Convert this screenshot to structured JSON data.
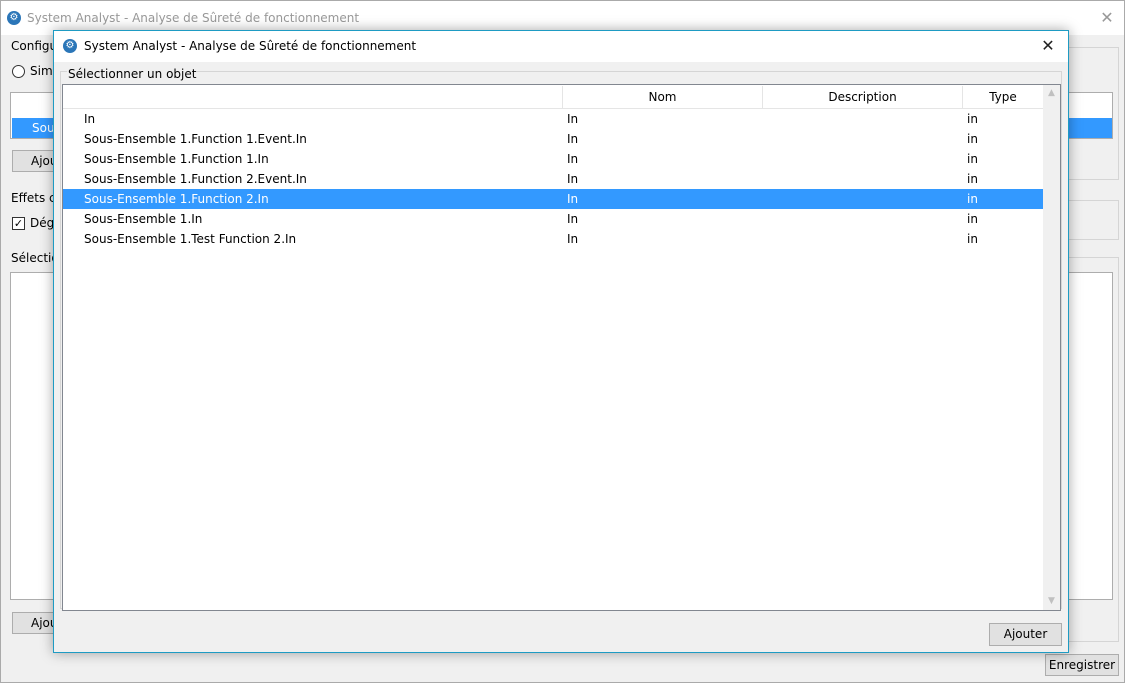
{
  "background_window": {
    "title": "System Analyst - Analyse de Sûreté de fonctionnement",
    "close_glyph": "✕",
    "configuration_label": "Configu",
    "radio_label": "Simp",
    "list_selected_item": "Sous",
    "add_button_1": "Ajou",
    "effects_label": "Effets co",
    "checkbox_label": "Dégr",
    "checkbox_checked": true,
    "selection_label": "Sélection",
    "add_button_2": "Ajou",
    "save_button": "Enregistrer"
  },
  "dialog": {
    "title": "System Analyst - Analyse de Sûreté de fonctionnement",
    "close_glyph": "✕",
    "icon": "gear-icon",
    "group_label": "Sélectionner un objet",
    "columns": {
      "nom": "Nom",
      "description": "Description",
      "type": "Type"
    },
    "rows": [
      {
        "name": "In",
        "nom": "In",
        "description": "",
        "type": "in",
        "selected": false
      },
      {
        "name": "Sous-Ensemble 1.Function 1.Event.In",
        "nom": "In",
        "description": "",
        "type": "in",
        "selected": false
      },
      {
        "name": "Sous-Ensemble 1.Function 1.In",
        "nom": "In",
        "description": "",
        "type": "in",
        "selected": false
      },
      {
        "name": "Sous-Ensemble 1.Function 2.Event.In",
        "nom": "In",
        "description": "",
        "type": "in",
        "selected": false
      },
      {
        "name": "Sous-Ensemble 1.Function 2.In",
        "nom": "In",
        "description": "",
        "type": "in",
        "selected": true
      },
      {
        "name": "Sous-Ensemble 1.In",
        "nom": "In",
        "description": "",
        "type": "in",
        "selected": false
      },
      {
        "name": "Sous-Ensemble 1.Test Function 2.In",
        "nom": "In",
        "description": "",
        "type": "in",
        "selected": false
      }
    ],
    "add_button": "Ajouter"
  },
  "colors": {
    "selection": "#3399ff",
    "dialog_border": "#1e9bc3",
    "app_icon": "#2b76b8"
  }
}
